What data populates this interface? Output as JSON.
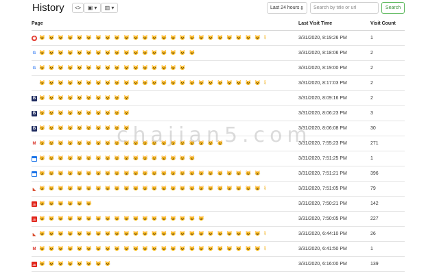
{
  "header": {
    "title": "History",
    "toolbar": {
      "code_label": "<>",
      "image_label": "▣ ▾",
      "layout_label": "▥ ▾"
    },
    "time_range": "Last 24 hours",
    "search_placeholder": "Search by title or url",
    "search_button": "Search"
  },
  "table": {
    "columns": [
      "Page",
      "Last Visit Time",
      "Visit Count"
    ],
    "rows": [
      {
        "icon": "red-circle-icon",
        "title": "😺 😺 😺 😺 😺 😺 😺 😺 😺 😺 😺 😺 😺 😺 😺 😺 😺 😺 😺 😺 😺 😺 😺 😺 😺 😺 😺 😺",
        "time": "3/31/2020, 8:19:26 PM",
        "count": "1"
      },
      {
        "icon": "google-icon",
        "title": "😺 😺 😺 😺 😺 😺 😺 😺 😺 😺 😺 😺 😺 😺 😺 😺 😺",
        "time": "3/31/2020, 8:18:06 PM",
        "count": "2"
      },
      {
        "icon": "google-icon",
        "title": "😺 😺 😺 😺 😺 😺 😺 😺 😺 😺 😺 😺 😺 😺 😺 😺",
        "time": "3/31/2020, 8:19:00 PM",
        "count": "2"
      },
      {
        "icon": "none",
        "title": "😺 😺 😺 😺 😺 😺 😺 😺 😺 😺 😺 😺 😺 😺 😺 😺 😺 😺 😺 😺 😺 😺 😺 😺 😺 😺 😺 😺 😺 😺 😺 😺 ...",
        "time": "3/31/2020, 8:17:03 PM",
        "count": "2"
      },
      {
        "icon": "b-icon",
        "title": "😺 😺 😺 😺 😺 😺 😺 😺 😺 😺",
        "time": "3/31/2020, 8:09:16 PM",
        "count": "2"
      },
      {
        "icon": "b-icon",
        "title": "😺 😺 😺 😺 😺 😺 😺 😺 😺 😺",
        "time": "3/31/2020, 8:06:23 PM",
        "count": "3"
      },
      {
        "icon": "b-icon",
        "title": "😺 😺 😺 😺 😺 😺 😺 😺 😺 😺",
        "time": "3/31/2020, 8:06:08 PM",
        "count": "30"
      },
      {
        "icon": "gmail-icon",
        "title": "😺 😺 😺 😺 😺 😺 😺 😺 😺 😺 😺 😺 😺 😺 😺 😺 😺 😺 😺 😺",
        "time": "3/31/2020, 7:55:23 PM",
        "count": "271"
      },
      {
        "icon": "calendar-icon",
        "title": "😺 😺 😺 😺 😺 😺 😺 😺 😺 😺 😺 😺 😺 😺 😺 😺 😺",
        "time": "3/31/2020, 7:51:25 PM",
        "count": "1"
      },
      {
        "icon": "calendar-icon",
        "title": "😺 😺 😺 😺 😺 😺 😺 😺 😺 😺 😺 😺 😺 😺 😺 😺 😺 😺 😺 😺 😺 😺 😺 😺",
        "time": "3/31/2020, 7:51:21 PM",
        "count": "396"
      },
      {
        "icon": "shoe-icon",
        "title": "😺 😺 😺 😺 😺 😺 😺 😺 😺 😺 😺 😺 😺 😺 😺 😺 😺 😺 😺 😺 😺 😺 😺 😺 😺 😺 😺",
        "time": "3/31/2020, 7:51:05 PM",
        "count": "79"
      },
      {
        "icon": "jd-icon",
        "title": "😺 😺 😺 😺 😺 😺",
        "time": "3/31/2020, 7:50:21 PM",
        "count": "142"
      },
      {
        "icon": "jd-icon",
        "title": "😺 😺 😺 😺 😺 😺 😺 😺 😺 😺 😺 😺 😺 😺 😺 😺 😺 😺",
        "time": "3/31/2020, 7:50:05 PM",
        "count": "227"
      },
      {
        "icon": "shoe-icon",
        "title": "😺 😺 😺 😺 😺 😺 😺 😺 😺 😺 😺 😺 😺 😺 😺 😺 😺 😺 😺 😺 😺 😺 😺 😺 😺 😺",
        "time": "3/31/2020, 6:44:10 PM",
        "count": "26"
      },
      {
        "icon": "gmail-icon",
        "title": "😺 😺 😺 😺 😺 😺 😺 😺 😺 😺 😺 😺 😺 😺 😺 😺 😺 😺 😺 😺 😺 😺 😺 😺 😺 😺 😺 😺 😺 😺 😺 😺 ...",
        "time": "3/31/2020, 6:41:50 PM",
        "count": "1"
      },
      {
        "icon": "jd-icon",
        "title": "😺 😺 😺 😺 😺 😺 😺 😺",
        "time": "3/31/2020, 6:16:00 PM",
        "count": "139"
      }
    ]
  },
  "watermark": "chajian5.com",
  "colors": {
    "search_button_border": "#5cb85c",
    "row_border": "#e4e4e4"
  }
}
